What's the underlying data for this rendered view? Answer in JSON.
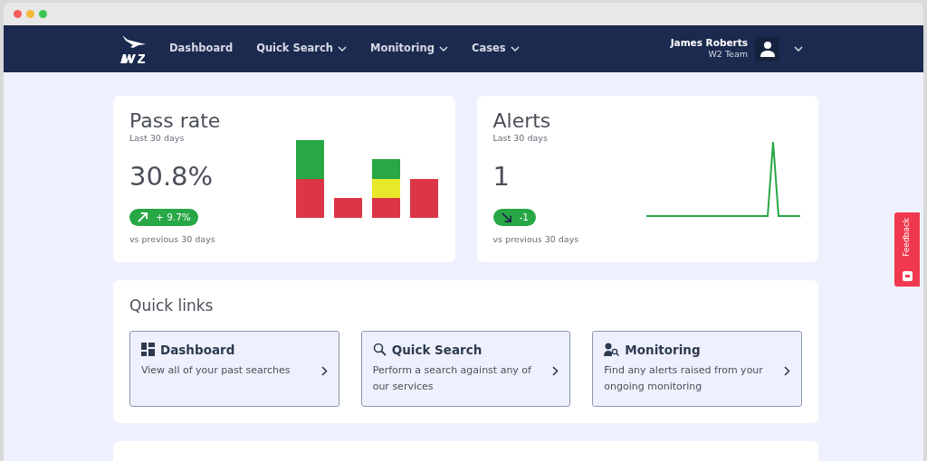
{
  "nav": {
    "items": [
      {
        "label": "Dashboard",
        "dropdown": false
      },
      {
        "label": "Quick Search",
        "dropdown": true
      },
      {
        "label": "Monitoring",
        "dropdown": true
      },
      {
        "label": "Cases",
        "dropdown": true
      }
    ],
    "user": {
      "name": "James Roberts",
      "team": "W2 Team"
    }
  },
  "stats": [
    {
      "title": "Pass rate",
      "period": "Last 30 days",
      "value": "30.8%",
      "change": "+ 9.7%",
      "note": "vs previous 30 days",
      "kind": "bars"
    },
    {
      "title": "Alerts",
      "period": "Last 30 days",
      "value": "1",
      "change": "-1",
      "note": "vs previous 30 days",
      "kind": "line"
    }
  ],
  "quick_links": {
    "title": "Quick links",
    "items": [
      {
        "title": "Dashboard",
        "text": "View all of your past searches"
      },
      {
        "title": "Quick Search",
        "text": "Perform a search against any of our services"
      },
      {
        "title": "Monitoring",
        "text": "Find any alerts raised from your ongoing monitoring"
      }
    ]
  },
  "feedback": "Feedback"
}
